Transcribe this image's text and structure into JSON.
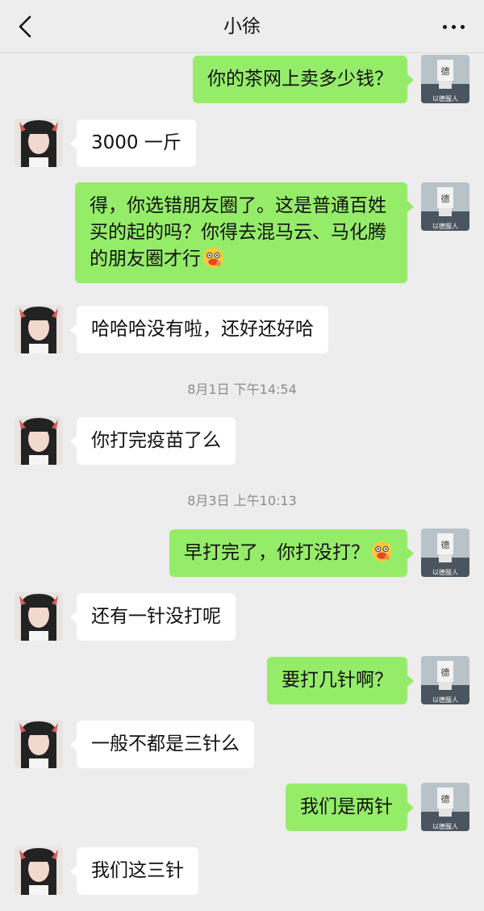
{
  "header": {
    "title": "小徐"
  },
  "messages": [
    {
      "side": "right",
      "text": "你的茶网上卖多少钱？"
    },
    {
      "side": "left",
      "text": "3000 一斤"
    },
    {
      "side": "right",
      "text": "得，你选错朋友圈了。这是普通百姓买的起的吗？你得去混马云、马化腾的朋友圈才行"
    },
    {
      "side": "left",
      "text": "哈哈哈没有啦，还好还好哈"
    },
    {
      "timestamp": "8月1日 下午14:54"
    },
    {
      "side": "left",
      "text": "你打完疫苗了么"
    },
    {
      "timestamp": "8月3日 上午10:13"
    },
    {
      "side": "right",
      "text": "早打完了，你打没打？"
    },
    {
      "side": "left",
      "text": "还有一针没打呢"
    },
    {
      "side": "right",
      "text": "要打几针啊？"
    },
    {
      "side": "left",
      "text": "一般不都是三针么"
    },
    {
      "side": "right",
      "text": "我们是两针"
    },
    {
      "side": "left",
      "text": "我们这三针"
    }
  ],
  "avatars": {
    "me_caption": "以德服人",
    "me_glyph": "德"
  },
  "colors": {
    "out_bubble": "#95ec69",
    "in_bubble": "#ffffff",
    "background": "#ededed"
  }
}
